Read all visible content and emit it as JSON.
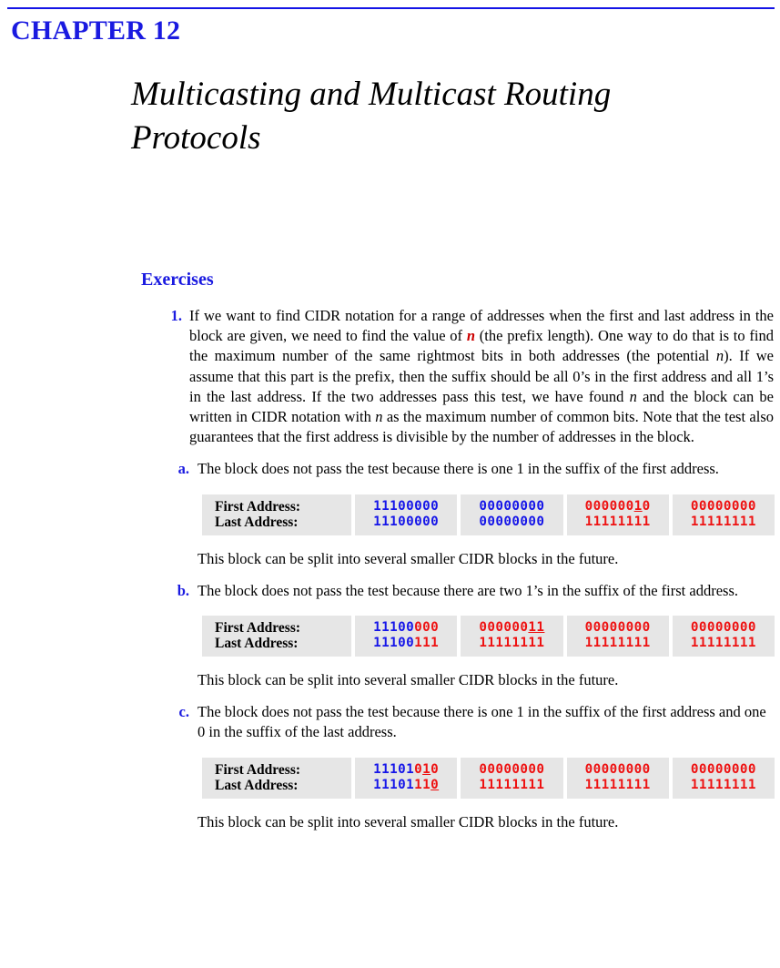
{
  "page": {
    "rule_color": "#1414e6",
    "heading_color": "#1a1ae0",
    "bit_blue": "#1515e8",
    "bit_red": "#ee1111",
    "cell_bg": "#e6e6e6"
  },
  "chapter": {
    "label": "CHAPTER 12",
    "title": "Multicasting and Multicast Routing Protocols"
  },
  "exercises": {
    "heading": "Exercises",
    "item1": {
      "number": "1.",
      "text_part1": "If we want to find CIDR notation for a range of addresses when the first and last address in the block are given, we need to find the value of ",
      "var1": "n",
      "text_part2": " (the prefix length). One way to do that is to find the maximum number of the same rightmost bits in both addresses (the potential ",
      "var2": "n",
      "text_part3": "). If we assume that this part is the prefix, then the suffix should be all 0’s in the first address and all 1’s in the last address. If the two addresses pass this test, we have found ",
      "var3": "n",
      "text_part4": " and the block can be written in CIDR notation with ",
      "var4": "n",
      "text_part5": " as the maximum number of common bits. Note that the test also guarantees that the first address is divisible by the number of addresses in the block."
    },
    "note_text": "This block can be split into several smaller CIDR blocks in the future.",
    "row_labels": {
      "first": "First Address:",
      "last": "Last Address:"
    },
    "subitems": [
      {
        "letter": "a.",
        "text": "The block does not pass the test because there is one 1 in the suffix of the first address.",
        "table": {
          "first": [
            [
              {
                "t": "11100000",
                "c": "blue",
                "u": false
              }
            ],
            [
              {
                "t": "00000000",
                "c": "blue",
                "u": false
              }
            ],
            [
              {
                "t": "000000",
                "c": "red",
                "u": false
              },
              {
                "t": "1",
                "c": "red",
                "u": true
              },
              {
                "t": "0",
                "c": "red",
                "u": false
              }
            ],
            [
              {
                "t": "00000000",
                "c": "red",
                "u": false
              }
            ]
          ],
          "last": [
            [
              {
                "t": "11100000",
                "c": "blue",
                "u": false
              }
            ],
            [
              {
                "t": "00000000",
                "c": "blue",
                "u": false
              }
            ],
            [
              {
                "t": "11111111",
                "c": "red",
                "u": false
              }
            ],
            [
              {
                "t": "11111111",
                "c": "red",
                "u": false
              }
            ]
          ]
        }
      },
      {
        "letter": "b.",
        "text": "The block does not pass the test because there are two 1’s in the suffix of the first address.",
        "table": {
          "first": [
            [
              {
                "t": "11100",
                "c": "blue",
                "u": false
              },
              {
                "t": "000",
                "c": "red",
                "u": false
              }
            ],
            [
              {
                "t": "000000",
                "c": "red",
                "u": false
              },
              {
                "t": "11",
                "c": "red",
                "u": true
              }
            ],
            [
              {
                "t": "00000000",
                "c": "red",
                "u": false
              }
            ],
            [
              {
                "t": "00000000",
                "c": "red",
                "u": false
              }
            ]
          ],
          "last": [
            [
              {
                "t": "11100",
                "c": "blue",
                "u": false
              },
              {
                "t": "111",
                "c": "red",
                "u": false
              }
            ],
            [
              {
                "t": "11111111",
                "c": "red",
                "u": false
              }
            ],
            [
              {
                "t": "11111111",
                "c": "red",
                "u": false
              }
            ],
            [
              {
                "t": "11111111",
                "c": "red",
                "u": false
              }
            ]
          ]
        }
      },
      {
        "letter": "c.",
        "text": "The block does not pass the test because there is one 1 in the suffix of the first address and one 0 in the suffix of the last address.",
        "table": {
          "first": [
            [
              {
                "t": "11101",
                "c": "blue",
                "u": false
              },
              {
                "t": "0",
                "c": "red",
                "u": false
              },
              {
                "t": "1",
                "c": "red",
                "u": true
              },
              {
                "t": "0",
                "c": "red",
                "u": false
              }
            ],
            [
              {
                "t": "00000000",
                "c": "red",
                "u": false
              }
            ],
            [
              {
                "t": "00000000",
                "c": "red",
                "u": false
              }
            ],
            [
              {
                "t": "00000000",
                "c": "red",
                "u": false
              }
            ]
          ],
          "last": [
            [
              {
                "t": "11101",
                "c": "blue",
                "u": false
              },
              {
                "t": "11",
                "c": "red",
                "u": false
              },
              {
                "t": "0",
                "c": "red",
                "u": true
              }
            ],
            [
              {
                "t": "11111111",
                "c": "red",
                "u": false
              }
            ],
            [
              {
                "t": "11111111",
                "c": "red",
                "u": false
              }
            ],
            [
              {
                "t": "11111111",
                "c": "red",
                "u": false
              }
            ]
          ]
        }
      }
    ]
  }
}
